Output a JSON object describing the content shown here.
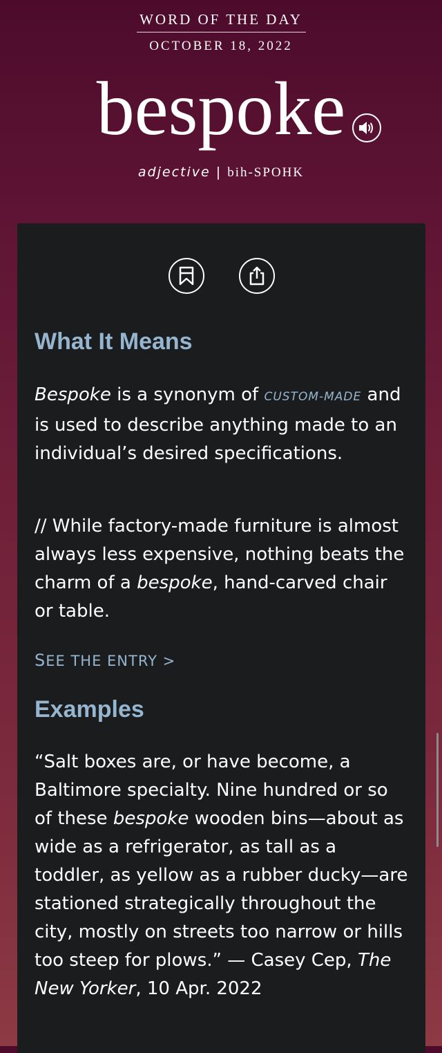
{
  "header": {
    "label": "WORD OF THE DAY",
    "date": "OCTOBER 18, 2022",
    "word": "bespoke",
    "part_of_speech": "adjective",
    "separator": "|",
    "pronunciation": "bih-SPOHK"
  },
  "icons": {
    "audio": "speaker-icon",
    "save": "bookmark-icon",
    "share": "share-icon"
  },
  "meaning": {
    "heading": "What It Means",
    "def_word": "Bespoke",
    "def_text_1": " is a synonym of ",
    "def_xref": "CUSTOM-MADE",
    "def_text_2": " and is used to describe anything made to an individual’s desired specifications.",
    "ex_text_1": "// While factory-made furniture is almost always less expensive, nothing beats the charm of a ",
    "ex_word": "bespoke",
    "ex_text_2": ", hand-carved chair or table.",
    "entry_link_first": "S",
    "entry_link_rest": "EE THE ENTRY",
    "entry_link_arrow": ">"
  },
  "examples": {
    "heading": "Examples",
    "quote_1": "“Salt boxes are, or have become, a Baltimore specialty. Nine hundred or so of these ",
    "quote_word": "bespoke",
    "quote_2": " wooden bins—about as wide as a refrigerator, as tall as a toddler, as yellow as a rubber ducky—are stationed strategically throughout the city, mostly on streets too narrow or hills too steep for plows.” — Casey Cep, ",
    "source": "The New Yorker",
    "date": ", 10 Apr. 2022"
  },
  "colors": {
    "accent": "#96b6cf",
    "card_bg": "#1b1c1e",
    "bg_top": "#4d0b2b",
    "bg_bottom": "#8d3a44"
  }
}
